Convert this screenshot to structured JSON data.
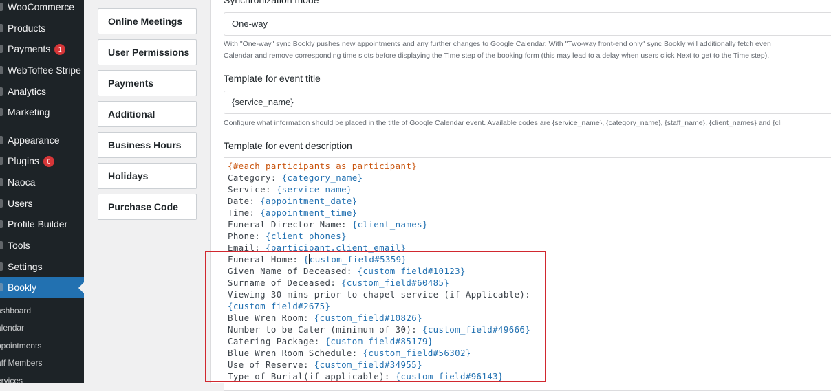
{
  "sidebar": {
    "items": [
      {
        "label": "WooCommerce",
        "badge": ""
      },
      {
        "label": "Products",
        "badge": ""
      },
      {
        "label": "Payments",
        "badge": "1"
      },
      {
        "label": "WebToffee Stripe",
        "badge": ""
      },
      {
        "label": "Analytics",
        "badge": ""
      },
      {
        "label": "Marketing",
        "badge": ""
      },
      {
        "label": "Appearance",
        "badge": ""
      },
      {
        "label": "Plugins",
        "badge": "6"
      },
      {
        "label": "Naoca",
        "badge": ""
      },
      {
        "label": "Users",
        "badge": ""
      },
      {
        "label": "Profile Builder",
        "badge": ""
      },
      {
        "label": "Tools",
        "badge": ""
      },
      {
        "label": "Settings",
        "badge": ""
      },
      {
        "label": "Bookly",
        "badge": ""
      }
    ],
    "submenu": [
      "ashboard",
      "alendar",
      "ppointments",
      "aff Members",
      "ervices"
    ]
  },
  "settings_nav": [
    "Online Meetings",
    "User Permissions",
    "Payments",
    "Additional",
    "Business Hours",
    "Holidays",
    "Purchase Code"
  ],
  "panel": {
    "sync_label": "Synchronization mode",
    "sync_value": "One-way",
    "sync_help_1": "With \"One-way\" sync Bookly pushes new appointments and any further changes to Google Calendar. With \"Two-way front-end only\" sync Bookly will additionally fetch even",
    "sync_help_2": "Calendar and remove corresponding time slots before displaying the Time step of the booking form (this may lead to a delay when users click Next to get to the Time step).",
    "title_label": "Template for event title",
    "title_value": "{service_name}",
    "title_help": "Configure what information should be placed in the title of Google Calendar event. Available codes are {service_name}, {category_name}, {staff_name}, {client_names} and {cli",
    "desc_label": "Template for event description"
  },
  "description_lines": [
    {
      "text": "",
      "code": "{#each participants as participant}",
      "kw": true
    },
    {
      "text": "Category: ",
      "code": "{category_name}"
    },
    {
      "text": "Service: ",
      "code": "{service_name}"
    },
    {
      "text": "Date: ",
      "code": "{appointment_date}"
    },
    {
      "text": "Time: ",
      "code": "{appointment_time}"
    },
    {
      "text": "Funeral Director Name: ",
      "code": "{client_names}"
    },
    {
      "text": "Phone: ",
      "code": "{client_phones}"
    },
    {
      "text": "Email: ",
      "code": "{participant.client_email}"
    },
    {
      "text": "Funeral Home: ",
      "code": "{custom_field#5359}",
      "caret": true
    },
    {
      "text": "Given Name of Deceased: ",
      "code": "{custom_field#10123}"
    },
    {
      "text": "Surname of Deceased: ",
      "code": "{custom_field#60485}"
    },
    {
      "text": "Viewing 30 mins prior to chapel service (if Applicable):",
      "code": ""
    },
    {
      "text": "",
      "code": "{custom_field#2675}"
    },
    {
      "text": "Blue Wren Room: ",
      "code": "{custom_field#10826}"
    },
    {
      "text": "Number to be Cater (minimum of 30): ",
      "code": "{custom_field#49666}"
    },
    {
      "text": "Catering Package: ",
      "code": "{custom_field#85179}"
    },
    {
      "text": "Blue Wren Room Schedule: ",
      "code": "{custom_field#56302}"
    },
    {
      "text": "Use of Reserve: ",
      "code": "{custom_field#34955}"
    },
    {
      "text": "Type of Burial(if applicable): ",
      "code": "{custom_field#96143}"
    }
  ]
}
